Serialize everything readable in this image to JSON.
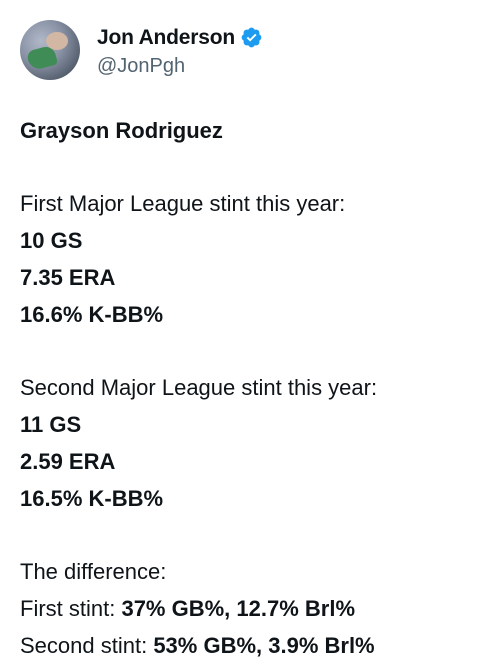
{
  "author": {
    "display_name": "Jon Anderson",
    "handle": "@JonPgh",
    "verified_icon": "verified-badge-icon",
    "accent_color": "#1d9bf0"
  },
  "tweet": {
    "title": "Grayson Rodriguez",
    "first_stint": {
      "heading": "First Major League stint this year:",
      "stats": [
        "10 GS",
        "7.35 ERA",
        "16.6% K-BB%"
      ]
    },
    "second_stint": {
      "heading": "Second Major League stint this year:",
      "stats": [
        "11 GS",
        "2.59 ERA",
        "16.5% K-BB%"
      ]
    },
    "difference": {
      "heading": "The difference:",
      "first_label": "First stint: ",
      "first_value": "37% GB%, 12.7% Brl%",
      "second_label": "Second stint: ",
      "second_value": "53% GB%, 3.9% Brl%"
    }
  }
}
